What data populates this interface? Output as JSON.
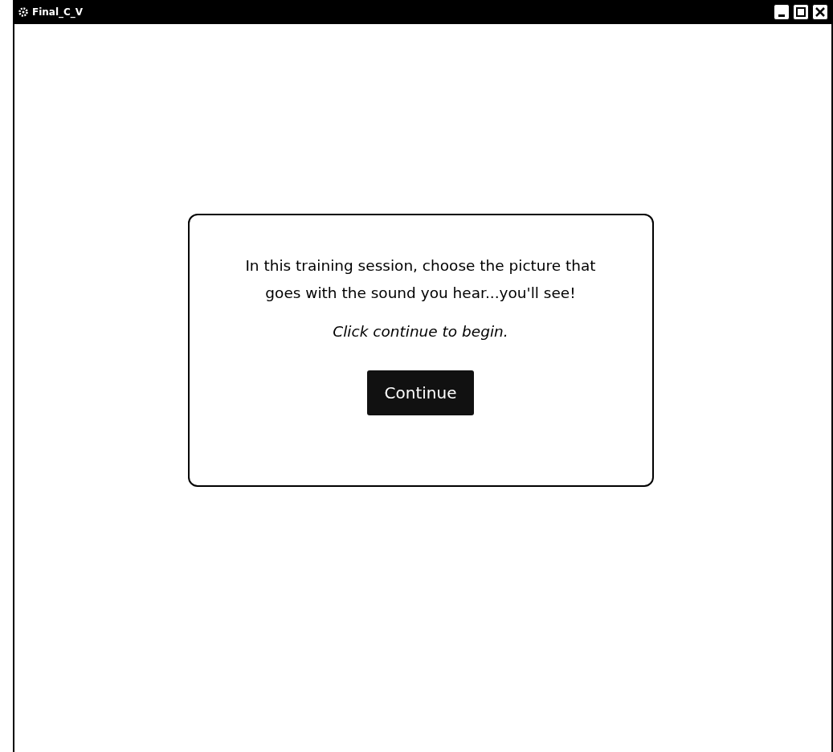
{
  "window": {
    "title": "Final_C_V"
  },
  "dialog": {
    "message": "In this training session, choose the picture that goes with the sound you hear...you'll see!",
    "instruction": "Click continue to begin.",
    "button": "Continue"
  }
}
